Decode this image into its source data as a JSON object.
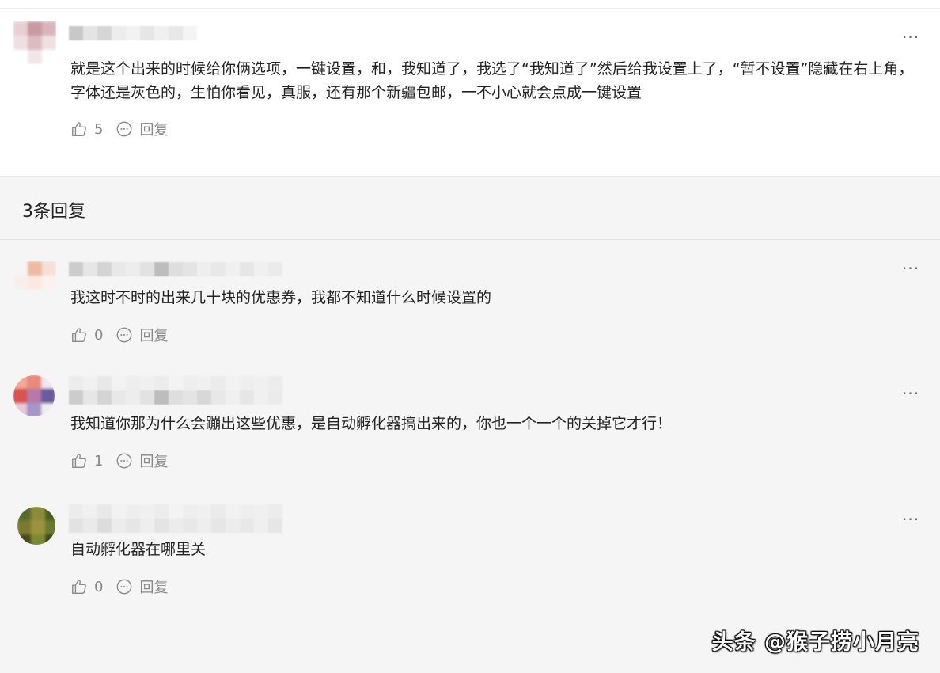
{
  "main_comment": {
    "text": "就是这个出来的时候给你俩选项，一键设置，和，我知道了，我选了“我知道了”然后给我设置上了，“暂不设置”隐藏在右上角，字体还是灰色的，生怕你看见，真服，还有那个新疆包邮，一不小心就会点成一键设置",
    "likes": "5",
    "reply_label": "回复",
    "more_label": "···"
  },
  "replies": {
    "header": "3条回复",
    "items": [
      {
        "text": "我这时不时的出来几十块的优惠券，我都不知道什么时候设置的",
        "likes": "0",
        "reply_label": "回复",
        "more_label": "···"
      },
      {
        "text": "我知道你那为什么会蹦出这些优惠，是自动孵化器搞出来的，你也一个一个的关掉它才行！",
        "likes": "1",
        "reply_label": "回复",
        "more_label": "···"
      },
      {
        "text": "自动孵化器在哪里关",
        "likes": "0",
        "reply_label": "回复",
        "more_label": "···"
      }
    ]
  },
  "watermark": "头条 @猴子捞小月亮",
  "icons": {
    "like": "thumbs-up-icon",
    "reply": "comment-bubble-icon",
    "more": "more-dots-icon"
  },
  "colors": {
    "text": "#222222",
    "muted": "#888888",
    "panel": "#f5f5f5"
  }
}
